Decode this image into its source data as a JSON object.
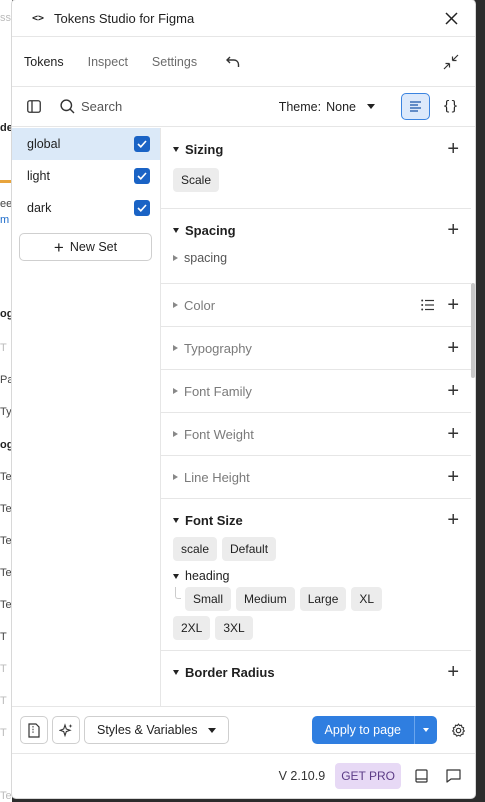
{
  "window": {
    "title": "Tokens Studio for Figma"
  },
  "tabs": [
    {
      "label": "Tokens",
      "active": true
    },
    {
      "label": "Inspect",
      "active": false
    },
    {
      "label": "Settings",
      "active": false
    }
  ],
  "toolbar": {
    "search_label": "Search",
    "theme_key": "Theme:",
    "theme_value": "None"
  },
  "sets": [
    {
      "label": "global",
      "checked": true,
      "selected": true
    },
    {
      "label": "light",
      "checked": true,
      "selected": false
    },
    {
      "label": "dark",
      "checked": true,
      "selected": false
    }
  ],
  "new_set_label": "New Set",
  "token_sections": [
    {
      "label": "Sizing",
      "open": true,
      "chips": [
        "Scale"
      ]
    },
    {
      "label": "Spacing",
      "open": true,
      "groups": [
        {
          "label": "spacing",
          "open": false
        }
      ]
    },
    {
      "label": "Color",
      "open": false
    },
    {
      "label": "Typography",
      "open": false
    },
    {
      "label": "Font Family",
      "open": false
    },
    {
      "label": "Font Weight",
      "open": false
    },
    {
      "label": "Line Height",
      "open": false
    },
    {
      "label": "Font Size",
      "open": true,
      "chips": [
        "scale",
        "Default"
      ],
      "groups": [
        {
          "label": "heading",
          "open": true,
          "chips": [
            "Small",
            "Medium",
            "Large",
            "XL",
            "2XL",
            "3XL"
          ]
        }
      ]
    },
    {
      "label": "Border Radius",
      "open": true
    }
  ],
  "footer": {
    "styles_label": "Styles & Variables",
    "apply_label": "Apply to page"
  },
  "status": {
    "version": "V 2.10.9",
    "pro_label": "GET PRO"
  },
  "background_fragments": [
    "ss",
    "de",
    "ee",
    "m",
    "og",
    "T",
    "Pa",
    "Ty",
    "og",
    "Te",
    "Te",
    "Te",
    "Te",
    "Te",
    "T",
    "T",
    "T",
    "T",
    "Text"
  ],
  "colors": {
    "accent": "#2f7ee0",
    "checkbox": "#1a63c5",
    "selected_row": "#dbe9f8",
    "pro_bg": "#e7d9f5"
  }
}
